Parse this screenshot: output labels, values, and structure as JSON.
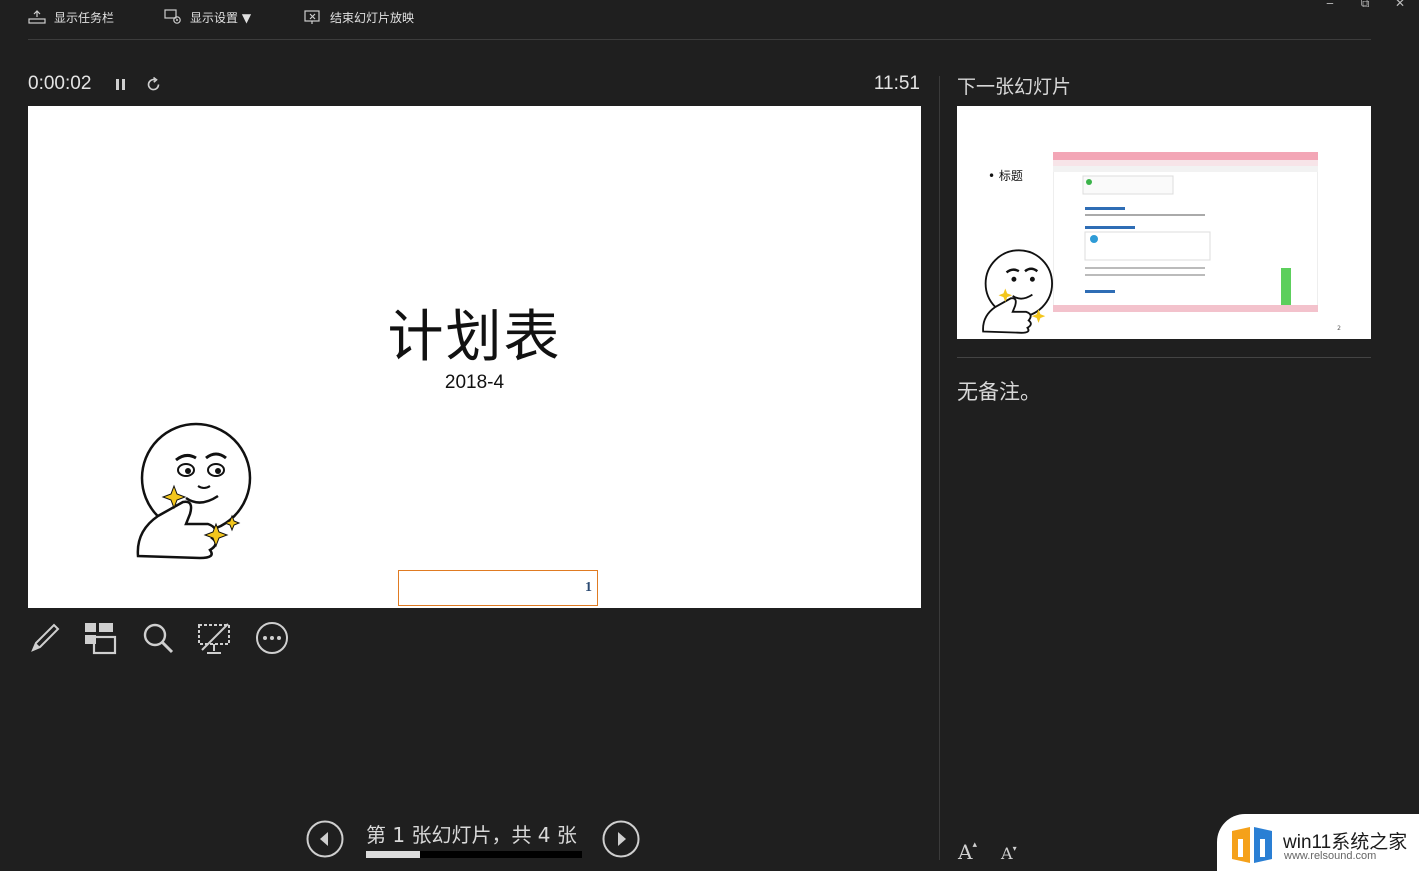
{
  "toolbar": {
    "show_taskbar": "显示任务栏",
    "display_settings": "显示设置 ▼",
    "end_slideshow": "结束幻灯片放映"
  },
  "window_controls": {
    "minimize": "‒",
    "restore": "⧉",
    "close": "✕"
  },
  "timer": {
    "elapsed": "0:00:02",
    "clock": "11:51"
  },
  "current_slide": {
    "title": "计划表",
    "subtitle": "2018-4",
    "slide_number": "1"
  },
  "tools": [
    "pen-icon",
    "see-all-slides-icon",
    "zoom-icon",
    "black-screen-icon",
    "more-options-icon"
  ],
  "next_slide": {
    "label": "下一张幻灯片",
    "bullet": "• 标题"
  },
  "notes": {
    "text": "无备注。"
  },
  "navigation": {
    "counter": "第 1 张幻灯片，共 4 张",
    "current": 1,
    "total": 4,
    "progress_fraction": 0.25
  },
  "font_buttons": {
    "increase": "A",
    "decrease": "A"
  },
  "watermark": {
    "name": "win11系统之家",
    "url": "www.relsound.com"
  },
  "colors": {
    "background": "#1f1f1f",
    "slide_number_box": "#e07b22",
    "text": "#d8d8d8"
  }
}
